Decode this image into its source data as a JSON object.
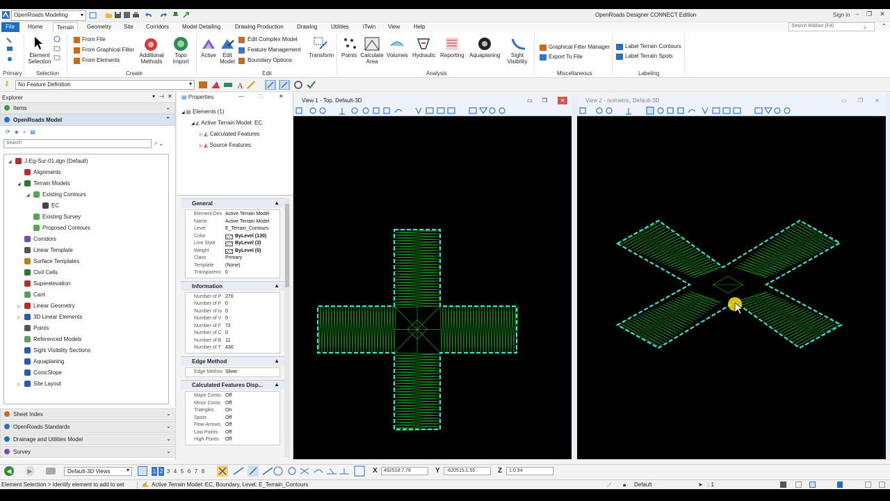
{
  "titlebar": {
    "workspace": "OpenRoads Modeling",
    "app_title": "OpenRoads Designer CONNECT Edition",
    "signin": "Sign in"
  },
  "ribbon_tabs": [
    "File",
    "Home",
    "Terrain",
    "Geometry",
    "Site",
    "Corridors",
    "Model Detailing",
    "Drawing Production",
    "Drawing",
    "Utilities",
    "iTwin",
    "View",
    "Help"
  ],
  "ribbon_search_placeholder": "Search Ribbon (F4)",
  "ribbon": {
    "primary_group": "Primary",
    "selection": {
      "element_selection": "Element Selection",
      "group": "Selection"
    },
    "create": {
      "from_file": "From File",
      "from_graphical_filter": "From Graphical Filter",
      "from_elements": "From Elements",
      "additional_methods": "Additional Methods",
      "topo_import": "Topo Import",
      "group": "Create"
    },
    "edit": {
      "active": "Active",
      "edit_model": "Edit Model",
      "edit_complex_model": "Edit Complex Model",
      "feature_management": "Feature Management",
      "boundary_options": "Boundary Options",
      "transform": "Transform",
      "group": "Edit"
    },
    "analysis": {
      "points": "Points",
      "calculate_area": "Calculate Area",
      "volumes": "Volumes",
      "hydraulic": "Hydraulic",
      "reporting": "Reporting",
      "aquaplaning": "Aquaplaning",
      "sight_visibility": "Sight Visibility",
      "group": "Analysis"
    },
    "misc": {
      "graphical_filter_manager": "Graphical Filter Manager",
      "export_to_file": "Export To File",
      "group": "Miscellaneous"
    },
    "labeling": {
      "label_terrain_contours": "Label Terrain Contours",
      "label_terrain_spots": "Label Terrain Spots",
      "group": "Labeling"
    }
  },
  "feature_definition": "No Feature Definition",
  "explorer": {
    "title": "Explorer",
    "items_section": "Items",
    "model_section": "OpenRoads Model",
    "search_placeholder": "Search",
    "tree": [
      {
        "label": "J-Eg-Sur-01.dgn (Default)",
        "level": 0,
        "toggle": "◢",
        "icon": "file-icon",
        "color": "#b03030"
      },
      {
        "label": "Alignments",
        "level": 1,
        "toggle": "",
        "icon": "alignment-icon",
        "color": "#b03030"
      },
      {
        "label": "Terrain Models",
        "level": 1,
        "toggle": "◢",
        "icon": "terrain-icon",
        "color": "#2a7a2a"
      },
      {
        "label": "Existing Contours",
        "level": 2,
        "toggle": "◢",
        "icon": "terrain-icon",
        "color": "#5aa25a"
      },
      {
        "label": "EC",
        "level": 3,
        "toggle": "",
        "icon": "grid-icon",
        "color": "#444444"
      },
      {
        "label": "Existing Survey",
        "level": 2,
        "toggle": "",
        "icon": "terrain-icon",
        "color": "#5aa25a"
      },
      {
        "label": "Proposed Contours",
        "level": 2,
        "toggle": "",
        "icon": "terrain-icon",
        "color": "#5aa25a"
      },
      {
        "label": "Corridors",
        "level": 1,
        "toggle": "",
        "icon": "corridor-icon",
        "color": "#7a4bb0"
      },
      {
        "label": "Linear Template",
        "level": 1,
        "toggle": "",
        "icon": "template-icon",
        "color": "#555555"
      },
      {
        "label": "Surface Templates",
        "level": 1,
        "toggle": "",
        "icon": "template-icon",
        "color": "#c08000"
      },
      {
        "label": "Civil Cells",
        "level": 1,
        "toggle": "",
        "icon": "cell-icon",
        "color": "#2a7a2a"
      },
      {
        "label": "Superelevation",
        "level": 1,
        "toggle": "",
        "icon": "superelevation-icon",
        "color": "#b03030"
      },
      {
        "label": "Cant",
        "level": 1,
        "toggle": "",
        "icon": "cant-icon",
        "color": "#5aa25a"
      },
      {
        "label": "Linear Geometry",
        "level": 1,
        "toggle": "▷",
        "icon": "linear-icon",
        "color": "#b03030"
      },
      {
        "label": "3D Linear Elements",
        "level": 1,
        "toggle": "▷",
        "icon": "linear3d-icon",
        "color": "#2a5ab0"
      },
      {
        "label": "Points",
        "level": 1,
        "toggle": "",
        "icon": "point-icon",
        "color": "#555555"
      },
      {
        "label": "Referenced Models",
        "level": 1,
        "toggle": "",
        "icon": "reference-icon",
        "color": "#5aa25a"
      },
      {
        "label": "Sight Visibility Sections",
        "level": 1,
        "toggle": "",
        "icon": "sight-icon",
        "color": "#2a5ab0"
      },
      {
        "label": "Aquaplaning",
        "level": 1,
        "toggle": "",
        "icon": "aquaplaning-icon",
        "color": "#2a5ab0"
      },
      {
        "label": "ConicSlope",
        "level": 1,
        "toggle": "",
        "icon": "conic-icon",
        "color": "#2a5ab0"
      },
      {
        "label": "Site Layout",
        "level": 1,
        "toggle": "▷",
        "icon": "site-icon",
        "color": "#2a5ab0"
      }
    ],
    "bottom_sections": [
      "Sheet Index",
      "OpenRoads Standards",
      "Drainage and Utilities Model",
      "Survey"
    ]
  },
  "properties": {
    "title": "Properties",
    "elements": "Elements (1)",
    "active_terrain": "Active Terrain Model: EC",
    "calculated_features": "Calculated Features",
    "source_features": "Source Features",
    "general": {
      "title": "General",
      "rows": [
        {
          "k": "Element Des",
          "v": "Active Terrain Model",
          "bold": false,
          "swatch": false
        },
        {
          "k": "Name",
          "v": "Active Terrain Model",
          "bold": false,
          "swatch": false
        },
        {
          "k": "Level",
          "v": "E_Terrain_Contours",
          "bold": false,
          "swatch": false
        },
        {
          "k": "Color",
          "v": "ByLevel (130)",
          "bold": true,
          "swatch": true
        },
        {
          "k": "Line Style",
          "v": "ByLevel (3)",
          "bold": true,
          "swatch": true
        },
        {
          "k": "Weight",
          "v": "ByLevel (0)",
          "bold": true,
          "swatch": true
        },
        {
          "k": "Class",
          "v": "Primary",
          "bold": false,
          "swatch": false
        },
        {
          "k": "Template",
          "v": "(None)",
          "bold": false,
          "swatch": false
        },
        {
          "k": "Transparenc",
          "v": "0",
          "bold": false,
          "swatch": false
        }
      ]
    },
    "information": {
      "title": "Information",
      "rows": [
        {
          "k": "Number of P",
          "v": "270"
        },
        {
          "k": "Number of P",
          "v": "0"
        },
        {
          "k": "Number of Is",
          "v": "0"
        },
        {
          "k": "Number of V",
          "v": "0"
        },
        {
          "k": "Number of F",
          "v": "72"
        },
        {
          "k": "Number of C",
          "v": "0"
        },
        {
          "k": "Number of B",
          "v": "11"
        },
        {
          "k": "Number of T",
          "v": "430"
        }
      ]
    },
    "edge": {
      "title": "Edge Method",
      "rows": [
        {
          "k": "Edge Methoc",
          "v": "Sliver"
        }
      ]
    },
    "calc_display": {
      "title": "Calculated Features Disp...",
      "rows": [
        {
          "k": "Major Conto",
          "v": "Off"
        },
        {
          "k": "Minor Conto",
          "v": "Off"
        },
        {
          "k": "Triangles",
          "v": "On"
        },
        {
          "k": "Spots",
          "v": "Off"
        },
        {
          "k": "Flow Arrows",
          "v": "Off"
        },
        {
          "k": "Low Points",
          "v": "Off"
        },
        {
          "k": "High Points",
          "v": "Off"
        }
      ]
    }
  },
  "views": {
    "view1_title": "View 1 - Top, Default-3D",
    "view2_title": "View 2 - Isometric, Default-3D"
  },
  "statusbar": {
    "view_group": "Default-3D Views",
    "view_numbers": [
      "1",
      "2",
      "3",
      "4",
      "5",
      "6",
      "7",
      "8"
    ],
    "x_label": "X",
    "x_value": "492518:7.78",
    "y_label": "Y",
    "y_value": "-620515:1.55",
    "z_label": "Z",
    "z_value": "1:0.34",
    "level": "Default",
    "selection_count": ": 1"
  },
  "prompt": {
    "left": "Element Selection > Identify element to add to set",
    "right": "Active Terrain Model: EC, Boundary, Level: E_Terrain_Contours"
  },
  "colors": {
    "accent": "#1b6ec2",
    "terrain_green": "#1fa31f",
    "boundary_cyan": "#3fe0d0",
    "cursor_yellow": "#ffe000"
  }
}
